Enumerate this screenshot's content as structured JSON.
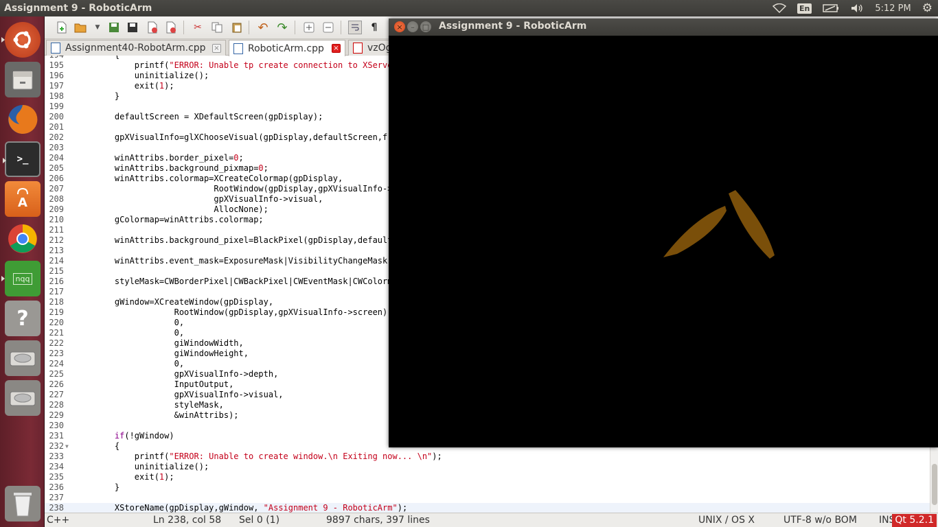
{
  "top_panel": {
    "title": "Assignment 9 - RoboticArm",
    "lang": "En",
    "time": "5:12 PM"
  },
  "launcher": {
    "items": [
      "ubuntu-dash",
      "files",
      "firefox",
      "terminal",
      "software-center",
      "chrome",
      "nqq",
      "help",
      "drive-1",
      "drive-2",
      "trash"
    ],
    "nqq_label": "nqq",
    "terminal_prompt": ">_",
    "help_glyph": "?"
  },
  "editor": {
    "tabs": [
      {
        "label": "Assignment40-RobotArm.cpp",
        "active": false
      },
      {
        "label": "RoboticArm.cpp",
        "active": true
      },
      {
        "label": "vzOg",
        "active": false
      }
    ],
    "lines": [
      {
        "n": "194",
        "t": "    {"
      },
      {
        "n": "195",
        "t": "        printf(\"ERROR: Unable tp create connection to XServer. \\n Exiting now... \\n\");"
      },
      {
        "n": "196",
        "t": "        uninitialize();"
      },
      {
        "n": "197",
        "t": "        exit(1);"
      },
      {
        "n": "198",
        "t": "    }"
      },
      {
        "n": "199",
        "t": ""
      },
      {
        "n": "200",
        "t": "    defaultScreen = XDefaultScreen(gpDisplay);"
      },
      {
        "n": "201",
        "t": ""
      },
      {
        "n": "202",
        "t": "    gpXVisualInfo=glXChooseVisual(gpDisplay,defaultScreen,frameBufferAttributes);"
      },
      {
        "n": "203",
        "t": ""
      },
      {
        "n": "204",
        "t": "    winAttribs.border_pixel=0;"
      },
      {
        "n": "205",
        "t": "    winAttribs.background_pixmap=0;"
      },
      {
        "n": "206",
        "t": "    winAttribs.colormap=XCreateColormap(gpDisplay,"
      },
      {
        "n": "207",
        "t": "                        RootWindow(gpDisplay,gpXVisualInfo->screen),"
      },
      {
        "n": "208",
        "t": "                        gpXVisualInfo->visual,"
      },
      {
        "n": "209",
        "t": "                        AllocNone);"
      },
      {
        "n": "210",
        "t": "    gColormap=winAttribs.colormap;"
      },
      {
        "n": "211",
        "t": ""
      },
      {
        "n": "212",
        "t": "    winAttribs.background_pixel=BlackPixel(gpDisplay,defaultScreen);"
      },
      {
        "n": "213",
        "t": ""
      },
      {
        "n": "214",
        "t": "    winAttribs.event_mask=ExposureMask|VisibilityChangeMask|ButtonPressMask;"
      },
      {
        "n": "215",
        "t": ""
      },
      {
        "n": "216",
        "t": "    styleMask=CWBorderPixel|CWBackPixel|CWEventMask|CWColormap;"
      },
      {
        "n": "217",
        "t": ""
      },
      {
        "n": "218",
        "t": "    gWindow=XCreateWindow(gpDisplay,"
      },
      {
        "n": "219",
        "t": "                RootWindow(gpDisplay,gpXVisualInfo->screen),"
      },
      {
        "n": "220",
        "t": "                0,"
      },
      {
        "n": "221",
        "t": "                0,"
      },
      {
        "n": "222",
        "t": "                giWindowWidth,"
      },
      {
        "n": "223",
        "t": "                giWindowHeight,"
      },
      {
        "n": "224",
        "t": "                0,"
      },
      {
        "n": "225",
        "t": "                gpXVisualInfo->depth,"
      },
      {
        "n": "226",
        "t": "                InputOutput,"
      },
      {
        "n": "227",
        "t": "                gpXVisualInfo->visual,"
      },
      {
        "n": "228",
        "t": "                styleMask,"
      },
      {
        "n": "229",
        "t": "                &winAttribs);"
      },
      {
        "n": "230",
        "t": ""
      },
      {
        "n": "231",
        "t": "    if(!gWindow)"
      },
      {
        "n": "232",
        "t": "    {"
      },
      {
        "n": "233",
        "t": "        printf(\"ERROR: Unable to create window.\\n Exiting now... \\n\");"
      },
      {
        "n": "234",
        "t": "        uninitialize();"
      },
      {
        "n": "235",
        "t": "        exit(1);"
      },
      {
        "n": "236",
        "t": "    }"
      },
      {
        "n": "237",
        "t": ""
      },
      {
        "n": "238",
        "t": "    XStoreName(gpDisplay,gWindow, \"Assignment 9 - RoboticArm\");"
      }
    ],
    "status": {
      "language": "C++",
      "position": "Ln 238, col 58",
      "selection": "Sel 0 (1)",
      "size": "9897 chars, 397 lines",
      "eol": "UNIX / OS X",
      "encoding": "UTF-8 w/o BOM",
      "mode": "INS",
      "qt": "Qt 5.2.1"
    }
  },
  "gl_window": {
    "title": "Assignment 9 - RoboticArm",
    "close_glyph": "×",
    "min_glyph": "–",
    "max_glyph": "□",
    "arm_color": "#7a4f0a"
  }
}
